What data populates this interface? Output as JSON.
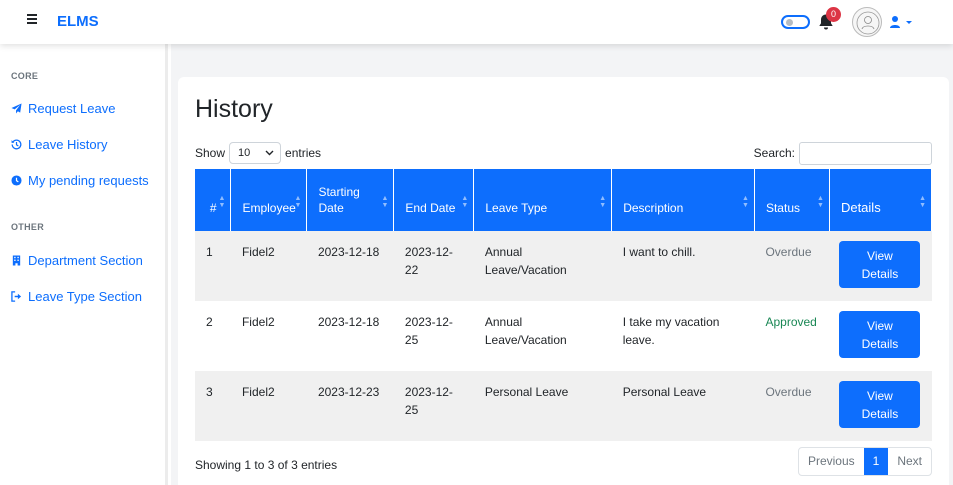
{
  "app": {
    "brand": "ELMS",
    "notification_count": "0"
  },
  "sidebar": {
    "core_heading": "CORE",
    "other_heading": "OTHER",
    "items": [
      {
        "label": "Request Leave",
        "icon": "paper-plane-icon"
      },
      {
        "label": "Leave History",
        "icon": "history-icon"
      },
      {
        "label": "My pending requests",
        "icon": "clock-icon"
      },
      {
        "label": "Department Section",
        "icon": "building-icon"
      },
      {
        "label": "Leave Type Section",
        "icon": "sign-out-icon"
      }
    ]
  },
  "page": {
    "title": "History",
    "show_label": "Show",
    "entries_value": "10",
    "entries_label": "entries",
    "search_label": "Search:",
    "search_value": "",
    "info": "Showing 1 to 3 of 3 entries",
    "pagination": {
      "previous": "Previous",
      "current": "1",
      "next": "Next"
    }
  },
  "table": {
    "headers": [
      "#",
      "Employee",
      "Starting Date",
      "End Date",
      "Leave Type",
      "Description",
      "Status",
      "Details"
    ],
    "rows": [
      {
        "num": "1",
        "employee": "Fidel2",
        "start": "2023-12-18",
        "end": "2023-12-22",
        "type": "Annual Leave/Vacation",
        "description": "I want to chill.",
        "status": "Overdue",
        "action": "View Details"
      },
      {
        "num": "2",
        "employee": "Fidel2",
        "start": "2023-12-18",
        "end": "2023-12-25",
        "type": "Annual Leave/Vacation",
        "description": "I take my vacation leave.",
        "status": "Approved",
        "action": "View Details"
      },
      {
        "num": "3",
        "employee": "Fidel2",
        "start": "2023-12-23",
        "end": "2023-12-25",
        "type": "Personal Leave",
        "description": "Personal Leave",
        "status": "Overdue",
        "action": "View Details"
      }
    ]
  },
  "colors": {
    "accent": "#0d6efd",
    "approved": "#198754",
    "overdue": "#6c757d",
    "badge": "#dc3545"
  }
}
